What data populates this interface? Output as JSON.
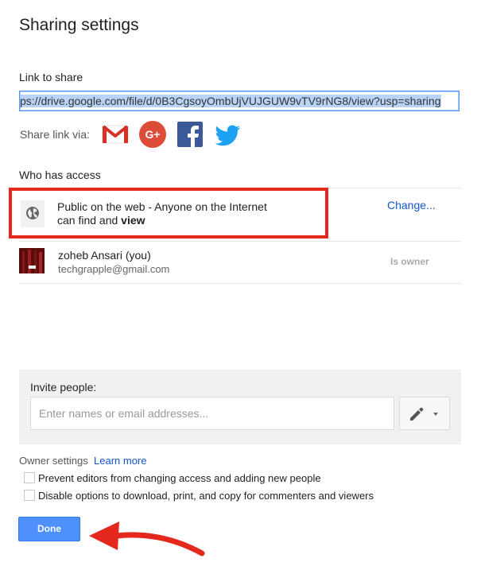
{
  "dialog": {
    "title": "Sharing settings"
  },
  "link": {
    "label": "Link to share",
    "url": "ps://drive.google.com/file/d/0B3CgsoyOmbUjVUJGUW9vTV9rNG8/view?usp=sharing"
  },
  "share_via": {
    "label": "Share link via:",
    "services": [
      "gmail-icon",
      "google-plus-icon",
      "facebook-icon",
      "twitter-icon"
    ]
  },
  "access": {
    "heading": "Who has access",
    "public": {
      "line1": "Public on the web - Anyone on the Internet",
      "line2_prefix": "can find and ",
      "line2_bold": "view",
      "change_label": "Change..."
    },
    "owner": {
      "name": "zoheb Ansari (you)",
      "email": "techgrapple@gmail.com",
      "role": "Is owner"
    }
  },
  "invite": {
    "label": "Invite people:",
    "placeholder": "Enter names or email addresses..."
  },
  "owner_settings": {
    "label": "Owner settings",
    "learn_more": "Learn more",
    "options": [
      {
        "label": "Prevent editors from changing access and adding new people",
        "checked": false
      },
      {
        "label": "Disable options to download, print, and copy for commenters and viewers",
        "checked": false
      }
    ]
  },
  "done_label": "Done",
  "colors": {
    "accent": "#4d90fe",
    "link": "#1155cc",
    "annotation_red": "#e4281e",
    "gmail_red": "#d93025",
    "gplus_red": "#dd4b39",
    "facebook_blue": "#3b5998",
    "twitter_blue": "#1da1f2"
  }
}
